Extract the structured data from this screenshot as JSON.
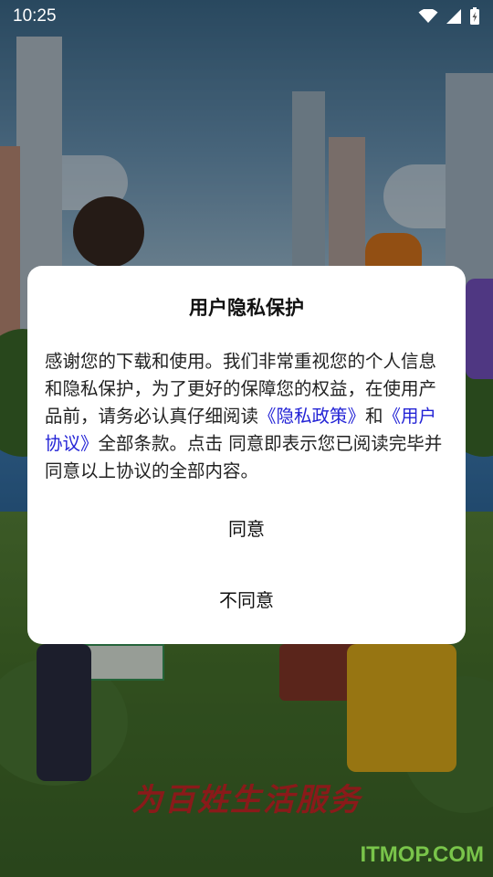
{
  "status_bar": {
    "time": "10:25"
  },
  "dialog": {
    "title": "用户隐私保护",
    "body_part1": "感谢您的下载和使用。我们非常重视您的个人信息和隐私保护，为了更好的保障您的权益，在使用产品前，请务必认真仔细阅读",
    "privacy_policy_link": "《隐私政策》",
    "body_and": "和",
    "user_agreement_link": "《用户协议》",
    "body_part2": "全部条款。点击 同意即表示您已阅读完毕并同意以上协议的全部内容。",
    "agree_label": "同意",
    "disagree_label": "不同意"
  },
  "background": {
    "slogan": "为百姓生活服务",
    "watermark": "ITMOP.COM"
  },
  "colors": {
    "link": "#2323d6",
    "slogan": "#8a1a1a",
    "watermark": "#79c44a"
  }
}
